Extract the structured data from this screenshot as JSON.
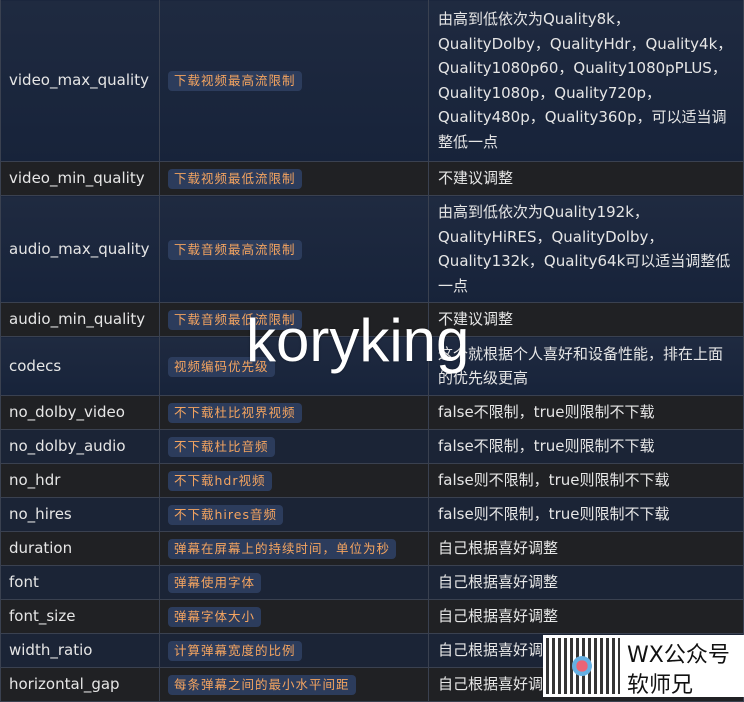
{
  "rows": [
    {
      "key": "video_max_quality",
      "desc": "下载视频最高流限制",
      "note": "由高到低依次为Quality8k，QualityDolby，QualityHdr，Quality4k，Quality1080p60，Quality1080pPLUS，Quality1080p，Quality720p，Quality480p，Quality360p，可以适当调整低一点"
    },
    {
      "key": "video_min_quality",
      "desc": "下载视频最低流限制",
      "note": "不建议调整"
    },
    {
      "key": "audio_max_quality",
      "desc": "下载音频最高流限制",
      "note": "由高到低依次为Quality192k，QualityHiRES，QualityDolby，Quality132k，Quality64k可以适当调整低一点"
    },
    {
      "key": "audio_min_quality",
      "desc": "下载音频最低流限制",
      "note": "不建议调整"
    },
    {
      "key": "codecs",
      "desc": "视频编码优先级",
      "note": "这个就根据个人喜好和设备性能，排在上面的优先级更高"
    },
    {
      "key": "no_dolby_video",
      "desc": "不下载杜比视界视频",
      "note": "false不限制，true则限制不下载"
    },
    {
      "key": "no_dolby_audio",
      "desc": "不下载杜比音频",
      "note": "false不限制，true则限制不下载"
    },
    {
      "key": "no_hdr",
      "desc": "不下载hdr视频",
      "note": "false则不限制，true则限制不下载"
    },
    {
      "key": "no_hires",
      "desc": "不下载hires音频",
      "note": "false则不限制，true则限制不下载"
    },
    {
      "key": "duration",
      "desc": "弹幕在屏幕上的持续时间，单位为秒",
      "note": "自己根据喜好调整"
    },
    {
      "key": "font",
      "desc": "弹幕使用字体",
      "note": "自己根据喜好调整"
    },
    {
      "key": "font_size",
      "desc": "弹幕字体大小",
      "note": "自己根据喜好调整"
    },
    {
      "key": "width_ratio",
      "desc": "计算弹幕宽度的比例",
      "note": "自己根据喜好调整"
    },
    {
      "key": "horizontal_gap",
      "desc": "每条弹幕之间的最小水平间距",
      "note": "自己根据喜好调整"
    }
  ],
  "watermark": {
    "text": "koryking"
  },
  "wx_badge": {
    "line1": "WX公众号",
    "line2": "软师兄"
  }
}
